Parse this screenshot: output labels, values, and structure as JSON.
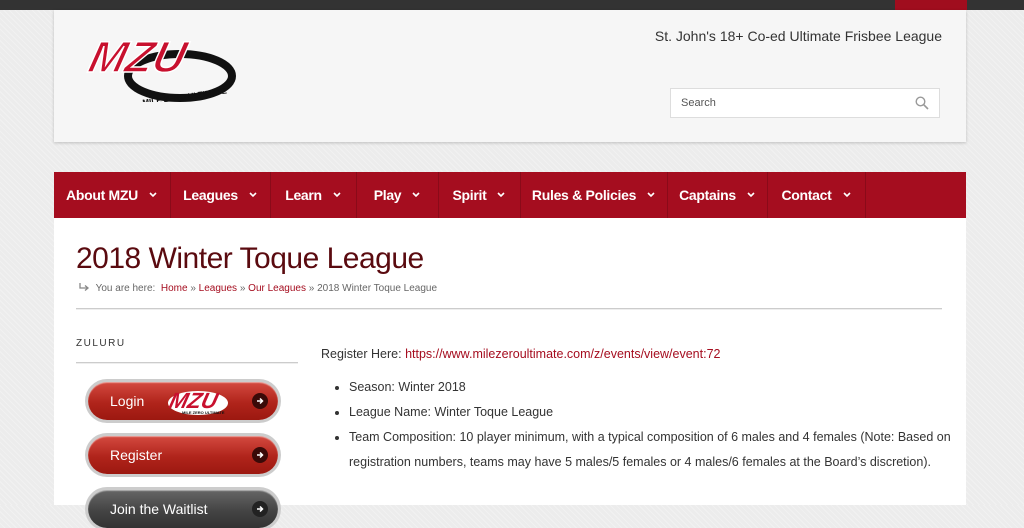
{
  "header": {
    "tagline": "St. John's 18+ Co-ed Ultimate Frisbee League",
    "logo_text": "MZU",
    "logo_subtext": "MILE ZERO ULTIMATE",
    "search_placeholder": "Search"
  },
  "nav": {
    "items": [
      {
        "label": "About MZU"
      },
      {
        "label": "Leagues"
      },
      {
        "label": "Learn"
      },
      {
        "label": "Play"
      },
      {
        "label": "Spirit"
      },
      {
        "label": "Rules & Policies"
      },
      {
        "label": "Captains"
      },
      {
        "label": "Contact"
      }
    ]
  },
  "page": {
    "title": "2018 Winter Toque League",
    "breadcrumb": {
      "prefix": "You are here:",
      "home": "Home",
      "leagues": "Leagues",
      "our_leagues": "Our Leagues",
      "current": "2018 Winter Toque League",
      "sep": "»"
    }
  },
  "sidebar": {
    "title": "ZULURU",
    "buttons": [
      {
        "label": "Login"
      },
      {
        "label": "Register"
      },
      {
        "label": "Join the Waitlist"
      }
    ]
  },
  "main": {
    "register_prefix": "Register Here:",
    "register_link": "https://www.milezeroultimate.com/z/events/view/event:72",
    "details": [
      "Season: Winter 2018",
      "League Name: Winter Toque League",
      "Team Composition:  10 player minimum, with a typical composition of 6 males and 4 females (Note: Based on registration numbers, teams may have 5 males/5 females or 4 males/6 females at the Board’s discretion)."
    ]
  },
  "colors": {
    "brand": "#a50d1f",
    "title": "#5a0a0f"
  }
}
